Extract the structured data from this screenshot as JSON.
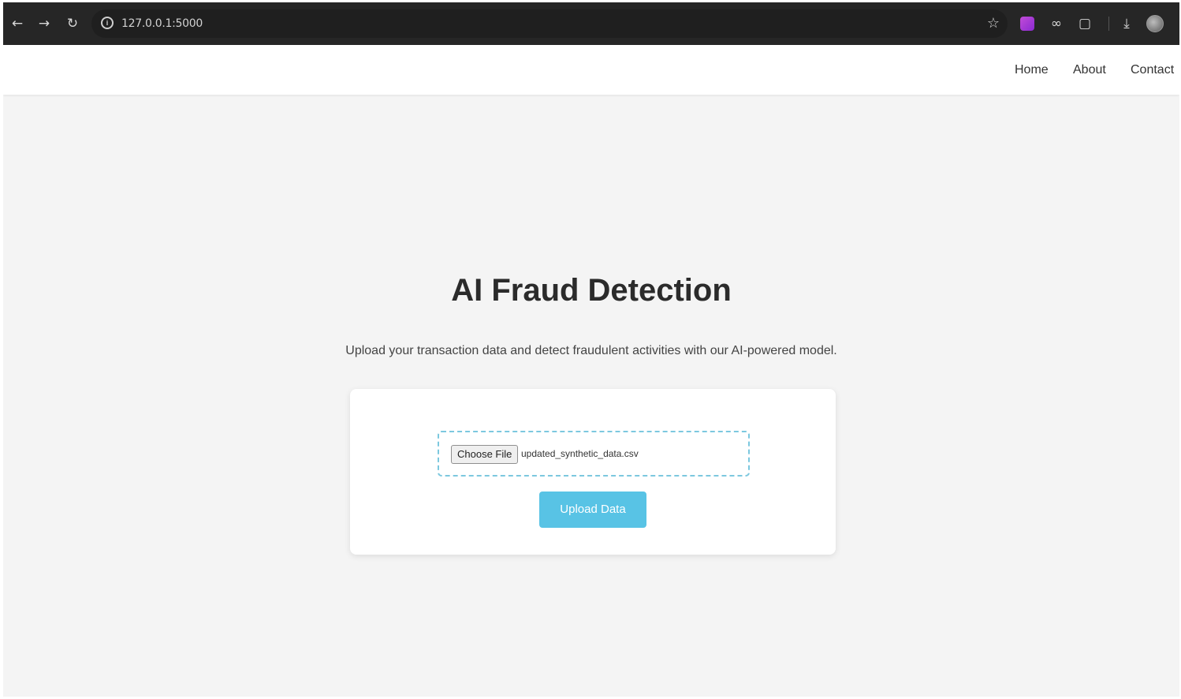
{
  "browser": {
    "url": "127.0.0.1:5000",
    "icons": {
      "back": "back-arrow-icon",
      "forward": "forward-arrow-icon",
      "reload": "reload-icon",
      "site_info": "site-info-icon",
      "bookmark": "star-icon",
      "extension": "extension-icon",
      "downloads": "download-icon",
      "profile": "profile-avatar-icon"
    }
  },
  "nav": {
    "links": [
      "Home",
      "About",
      "Contact"
    ]
  },
  "hero": {
    "title": "AI Fraud Detection",
    "subtitle": "Upload your transaction data and detect fraudulent activities with our AI-powered model."
  },
  "upload": {
    "choose_label": "Choose File",
    "file_name": "updated_synthetic_data.csv",
    "submit_label": "Upload Data"
  },
  "colors": {
    "accent": "#58c3e5",
    "page_bg": "#f4f4f4",
    "toolbar_bg": "#262626"
  }
}
